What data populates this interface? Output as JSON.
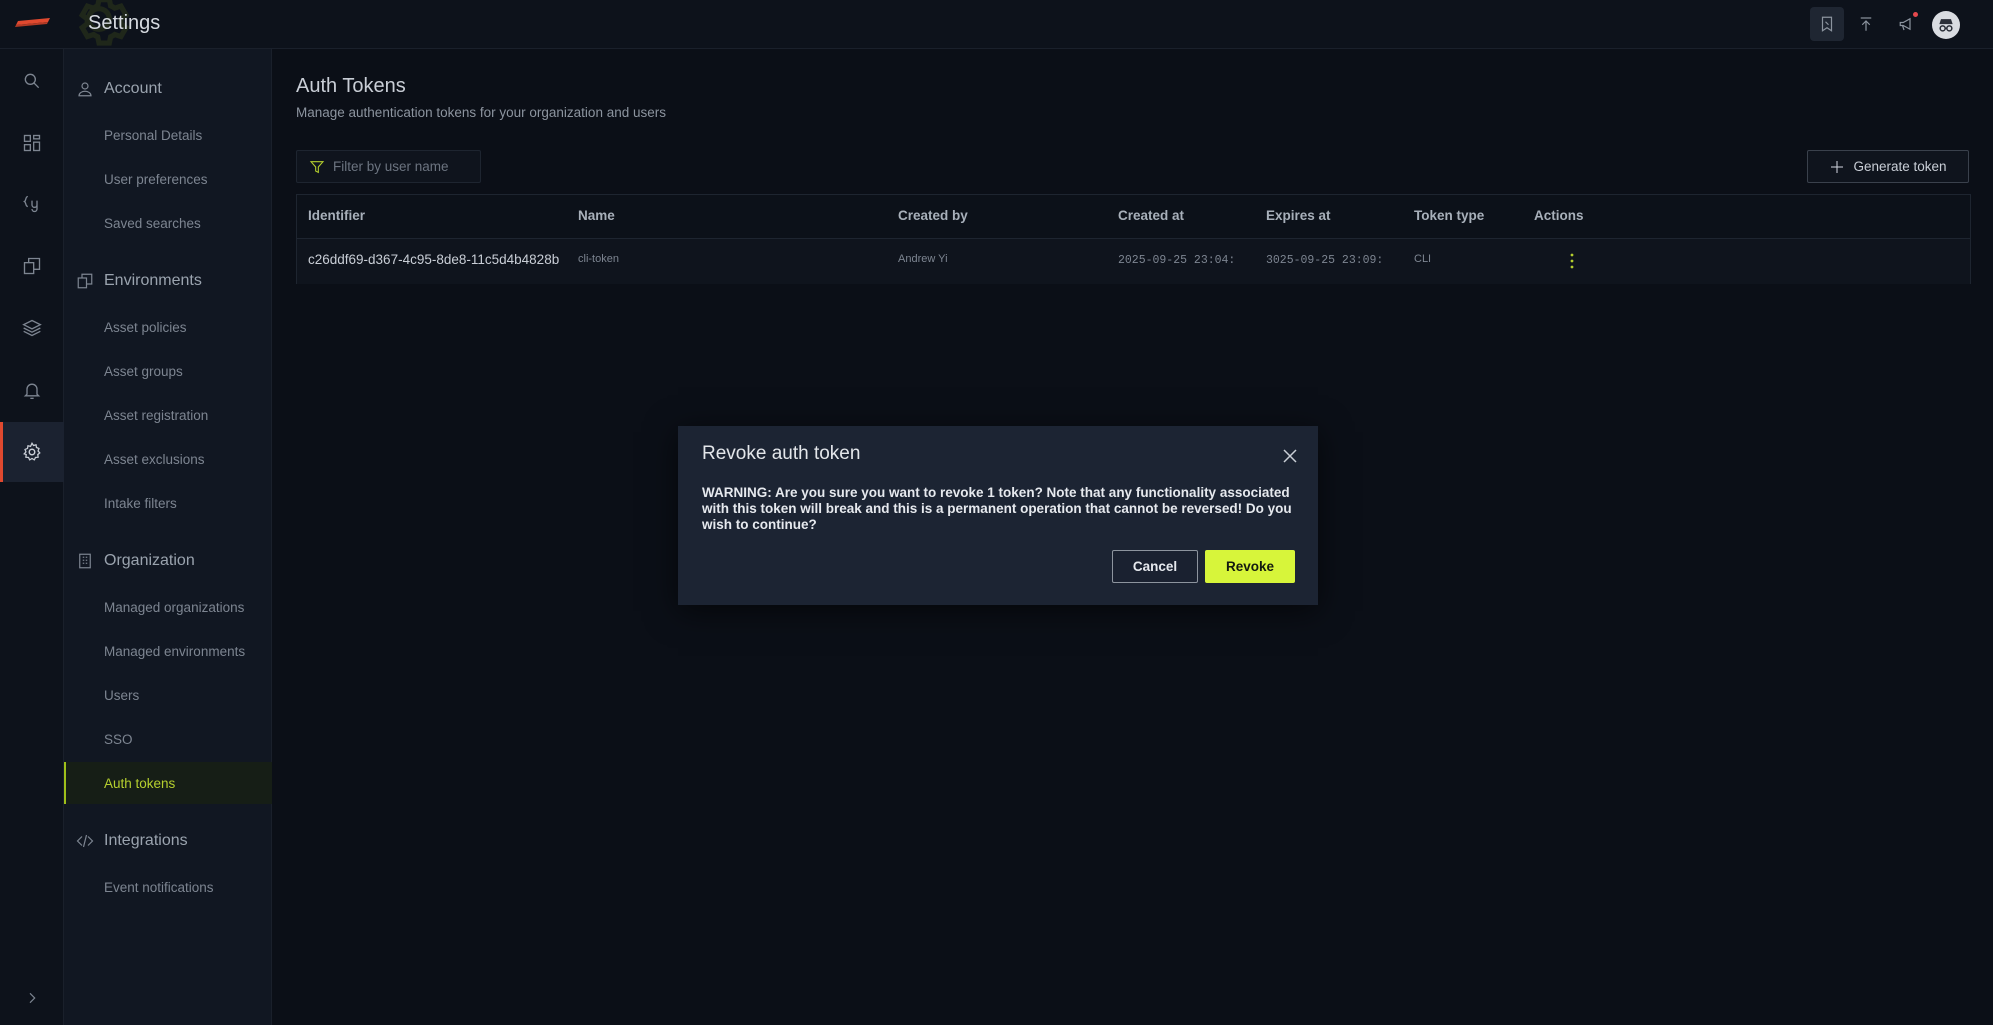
{
  "app": {
    "title": "Settings"
  },
  "topbar": {
    "icons": [
      "bookmark-icon",
      "upload-icon",
      "megaphone-icon",
      "incognito-avatar-icon"
    ]
  },
  "rail": {
    "icons": [
      "search-icon",
      "dashboard-icon",
      "query-icon",
      "reports-icon",
      "layers-icon",
      "bell-icon",
      "gear-icon"
    ],
    "active": "gear-icon",
    "expand_icon": "chevron-right-icon"
  },
  "sidebar": {
    "sections": [
      {
        "label": "Account",
        "icon": "user-icon",
        "items": [
          "Personal Details",
          "User preferences",
          "Saved searches"
        ]
      },
      {
        "label": "Environments",
        "icon": "environment-icon",
        "items": [
          "Asset policies",
          "Asset groups",
          "Asset registration",
          "Asset exclusions",
          "Intake filters"
        ]
      },
      {
        "label": "Organization",
        "icon": "building-icon",
        "items": [
          "Managed organizations",
          "Managed environments",
          "Users",
          "SSO",
          "Auth tokens"
        ]
      },
      {
        "label": "Integrations",
        "icon": "code-icon",
        "items": [
          "Event notifications"
        ]
      }
    ],
    "active_item": "Auth tokens"
  },
  "page": {
    "title": "Auth Tokens",
    "subtitle": "Manage authentication tokens for your organization and users",
    "filter_placeholder": "Filter by user name",
    "generate_label": "Generate token"
  },
  "table": {
    "columns": [
      "Identifier",
      "Name",
      "Created by",
      "Created at",
      "Expires at",
      "Token type",
      "Actions"
    ],
    "rows": [
      {
        "identifier": "c26ddf69-d367-4c95-8de8-11c5d4b4828b",
        "name": "cli-token",
        "created_by": "Andrew Yi",
        "created_at": "2025-09-25 23:04:",
        "expires_at": "3025-09-25 23:09:",
        "token_type": "CLI"
      }
    ]
  },
  "modal": {
    "title": "Revoke auth token",
    "body": "WARNING: Are you sure you want to revoke 1 token? Note that any functionality associated with this token will break and this is a permanent operation that cannot be reversed! Do you wish to continue?",
    "cancel_label": "Cancel",
    "revoke_label": "Revoke"
  },
  "colors": {
    "accent": "#d7f53a",
    "active_rail": "#e0492f",
    "background": "#0b0f17"
  }
}
